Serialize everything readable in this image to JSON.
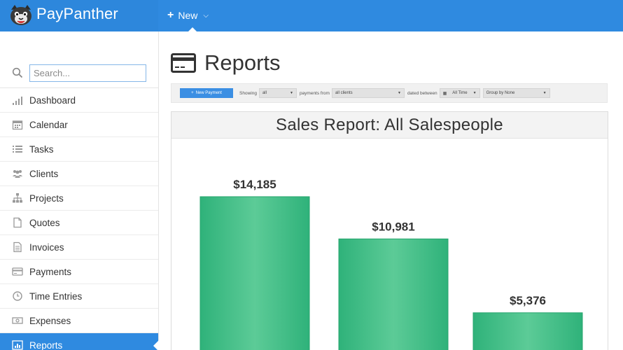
{
  "app": {
    "brand": "PayPanther",
    "new_label": "New"
  },
  "sidebar": {
    "search_placeholder": "Search...",
    "items": [
      {
        "label": "Dashboard",
        "icon": "bar-chart-icon"
      },
      {
        "label": "Calendar",
        "icon": "calendar-icon"
      },
      {
        "label": "Tasks",
        "icon": "list-icon"
      },
      {
        "label": "Clients",
        "icon": "users-icon"
      },
      {
        "label": "Projects",
        "icon": "sitemap-icon"
      },
      {
        "label": "Quotes",
        "icon": "document-icon"
      },
      {
        "label": "Invoices",
        "icon": "document-lines-icon"
      },
      {
        "label": "Payments",
        "icon": "credit-card-icon"
      },
      {
        "label": "Time Entries",
        "icon": "clock-icon"
      },
      {
        "label": "Expenses",
        "icon": "money-icon"
      },
      {
        "label": "Reports",
        "icon": "report-chart-icon",
        "active": true
      }
    ]
  },
  "page": {
    "title": "Reports",
    "title_icon": "credit-card-icon"
  },
  "filters": {
    "new_payment_label": "New Payment",
    "showing_label": "Showing",
    "showing_value": "all",
    "payments_from_label": "payments from",
    "clients_value": "all clients",
    "dated_between_label": "dated between",
    "date_value": "All Time",
    "group_value": "Group by None"
  },
  "report": {
    "title": "Sales Report: All Salespeople"
  },
  "colors": {
    "accent": "#2f8ae0",
    "bar": "#34b77d",
    "bar_light": "#5dcf9a"
  },
  "chart_data": {
    "type": "bar",
    "categories": [
      "",
      "",
      ""
    ],
    "values": [
      14185,
      10981,
      5376
    ],
    "data_labels": [
      "$14,185",
      "$10,981",
      "$5,376"
    ],
    "ylim": [
      0,
      17000
    ]
  }
}
